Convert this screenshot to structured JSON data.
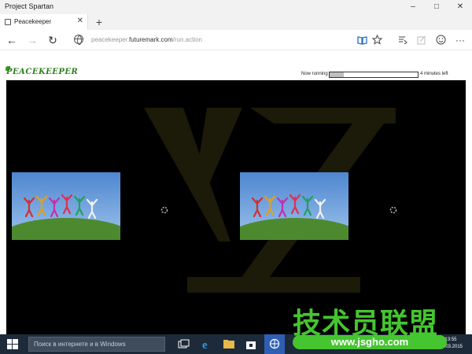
{
  "window": {
    "title": "Project Spartan",
    "controls": [
      "–",
      "□",
      "✕"
    ]
  },
  "tabs": [
    {
      "label": "Peacekeeper",
      "icon": "page-icon"
    }
  ],
  "new_tab_label": "+",
  "nav": {
    "url_prefix": "peacekeeper.",
    "url_domain": "futuremark.com",
    "url_path": "/run.action"
  },
  "page": {
    "logo_text": "PEACEKEEPER",
    "status_label": "Now running",
    "progress": 0.16,
    "remaining": "4 minutes left"
  },
  "taskbar": {
    "search_placeholder": "Поиск в интернете и в Windows",
    "time": "13:55",
    "date": "19.03.2015"
  },
  "overlay": {
    "brand": "技术员联盟",
    "site": "www.jsgho.com"
  },
  "colors": {
    "stage": "#000000",
    "logo": "#2f7f1f",
    "taskbar": "#1d2a3a",
    "overlay": "#45c52f"
  }
}
